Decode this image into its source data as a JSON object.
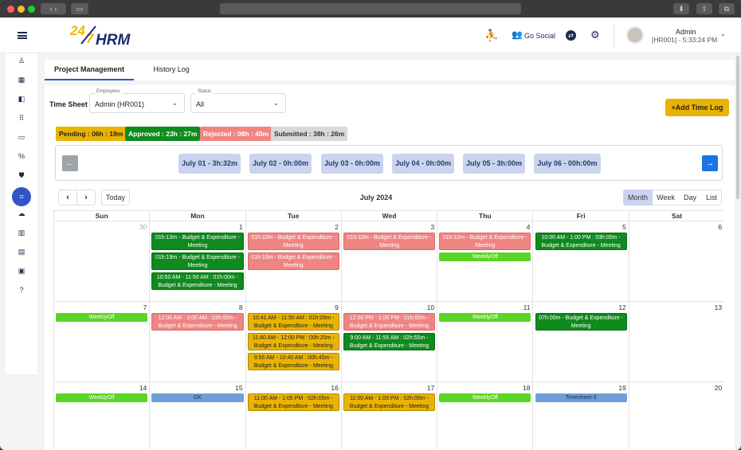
{
  "window": {
    "colors": {
      "close": "#ff5f57",
      "minimize": "#febc2e",
      "zoom": "#28c840"
    }
  },
  "header": {
    "logo_text": "24/7 HRM",
    "go_social_label": "Go Social",
    "user_name": "Admin",
    "user_sub": "[HR001] - 5:33:24 PM"
  },
  "tabs": [
    {
      "label": "Project Management",
      "active": true
    },
    {
      "label": "History Log",
      "active": false
    }
  ],
  "timesheet": {
    "label": "Time Sheet",
    "employees": {
      "label": "Employees",
      "value": "Admin (HR001)"
    },
    "status": {
      "label": "Status",
      "value": "All"
    },
    "add_button": "+Add Time Log"
  },
  "summary": [
    {
      "text": "Pending : 06h : 19m",
      "color": "#e9b303",
      "fg": "#222"
    },
    {
      "text": "Approved : 23h : 27m",
      "color": "#0f8a1e",
      "fg": "#fff"
    },
    {
      "text": "Rejected : 08h : 40m",
      "color": "#ef8582",
      "fg": "#fff"
    },
    {
      "text": "Submitted : 38h : 26m",
      "color": "#d9d9d9",
      "fg": "#333"
    }
  ],
  "day_totals": [
    "July 01 - 3h:32m",
    "July 02 - 0h:00m",
    "July 03 - 0h:00m",
    "July 04 - 0h:00m",
    "July 05 - 3h:00m",
    "July 06 - 00h:00m"
  ],
  "calendar": {
    "title": "July 2024",
    "today_label": "Today",
    "views": [
      "Month",
      "Week",
      "Day",
      "List"
    ],
    "active_view": "Month",
    "weekdays": [
      "Sun",
      "Mon",
      "Tue",
      "Wed",
      "Thu",
      "Fri",
      "Sat"
    ],
    "weeks": [
      [
        {
          "day": "30",
          "muted": true,
          "events": []
        },
        {
          "day": "1",
          "events": [
            {
              "text": "01h:13m - Budget & Expenditure - Meeting",
              "type": "g"
            },
            {
              "text": "01h:19m - Budget & Expenditure - Meeting",
              "type": "g"
            },
            {
              "text": "10:50 AM - 11:50 AM : 01h:00m - Budget & Expenditure - Meeting",
              "type": "g"
            }
          ]
        },
        {
          "day": "2",
          "events": [
            {
              "text": "01h:10m - Budget & Expenditure - Meeting",
              "type": "r"
            },
            {
              "text": "01h:10m - Budget & Expenditure - Meeting",
              "type": "r"
            }
          ]
        },
        {
          "day": "3",
          "events": [
            {
              "text": "01h:10m - Budget & Expenditure - Meeting",
              "type": "r"
            }
          ]
        },
        {
          "day": "4",
          "events": [
            {
              "text": "01h:10m - Budget & Expenditure - Meeting",
              "type": "r"
            },
            {
              "text": "WeeklyOff",
              "type": "lg"
            }
          ]
        },
        {
          "day": "5",
          "events": [
            {
              "text": "10:00 AM - 1:00 PM : 03h:00m - Budget & Expenditure - Meeting",
              "type": "g"
            }
          ]
        },
        {
          "day": "6",
          "events": []
        }
      ],
      [
        {
          "day": "7",
          "events": [
            {
              "text": "WeeklyOff",
              "type": "lg"
            }
          ]
        },
        {
          "day": "8",
          "events": [
            {
              "text": "12:00 AM - 3:00 AM : 03h:00m - Budget & Expenditure - Meeting",
              "type": "r"
            }
          ]
        },
        {
          "day": "9",
          "events": [
            {
              "text": "10:41 AM - 11:50 AM : 01h:09m - Budget & Expenditure - Meeting",
              "type": "y"
            },
            {
              "text": "11:40 AM - 12:00 PM : 00h:20m - Budget & Expenditure - Meeting",
              "type": "y"
            },
            {
              "text": "9:55 AM - 10:40 AM : 00h:45m - Budget & Expenditure - Meeting",
              "type": "y"
            }
          ]
        },
        {
          "day": "10",
          "events": [
            {
              "text": "12:00 PM - 1:00 PM : 01h:00m - Budget & Expenditure - Meeting",
              "type": "r"
            },
            {
              "text": "9:00 AM - 11:55 AM : 02h:55m - Budget & Expenditure - Meeting",
              "type": "g"
            }
          ]
        },
        {
          "day": "11",
          "events": [
            {
              "text": "WeeklyOff",
              "type": "lg"
            }
          ]
        },
        {
          "day": "12",
          "events": [
            {
              "text": "07h:00m - Budget & Expenditure - Meeting",
              "type": "g"
            }
          ]
        },
        {
          "day": "13",
          "events": []
        }
      ],
      [
        {
          "day": "14",
          "events": [
            {
              "text": "WeeklyOff",
              "type": "lg"
            }
          ]
        },
        {
          "day": "15",
          "events": [
            {
              "text": "OK",
              "type": "b"
            }
          ]
        },
        {
          "day": "16",
          "events": [
            {
              "text": "11:00 AM - 1:05 PM : 02h:05m - Budget & Expenditure - Meeting",
              "type": "y"
            }
          ]
        },
        {
          "day": "17",
          "events": [
            {
              "text": "11:00 AM - 1:00 PM : 02h:00m - Budget & Expenditure - Meeting",
              "type": "y"
            }
          ]
        },
        {
          "day": "18",
          "events": [
            {
              "text": "WeeklyOff",
              "type": "lg"
            }
          ]
        },
        {
          "day": "19",
          "events": [
            {
              "text": "Timesheet-3",
              "type": "b"
            }
          ]
        },
        {
          "day": "20",
          "events": []
        }
      ]
    ]
  }
}
